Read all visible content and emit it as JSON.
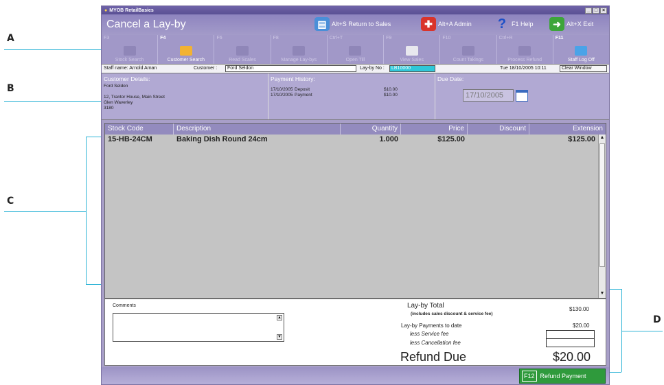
{
  "callouts": {
    "a": "A",
    "b": "B",
    "c": "C",
    "d": "D"
  },
  "window": {
    "title": "MYOB RetailBasics",
    "btn_min": "_",
    "btn_max": "□",
    "btn_close": "×"
  },
  "header": {
    "title": "Cancel a Lay-by",
    "return_sales": "Alt+S Return to Sales",
    "admin": "Alt+A Admin",
    "help": "F1 Help",
    "exit": "Alt+X Exit"
  },
  "fkeys": [
    {
      "key": "F3",
      "label": "Stock Search",
      "enabled": false
    },
    {
      "key": "F4",
      "label": "Customer Search",
      "enabled": true
    },
    {
      "key": "F6",
      "label": "Read Scales",
      "enabled": false
    },
    {
      "key": "F8",
      "label": "Manage Lay-bys",
      "enabled": false
    },
    {
      "key": "Ctrl+T",
      "label": "Open Till",
      "enabled": false
    },
    {
      "key": "F9",
      "label": "View Sales",
      "enabled": false
    },
    {
      "key": "F10",
      "label": "Count Takings",
      "enabled": false
    },
    {
      "key": "Ctrl+R",
      "label": "Process Refund",
      "enabled": false
    },
    {
      "key": "F11",
      "label": "Staff Log Off",
      "enabled": true
    }
  ],
  "infobar": {
    "staff": "Staff name: Arnold Aman",
    "customer_label": "Customer :",
    "customer_value": "Ford Seldon",
    "layby_label": "Lay-by No :",
    "layby_value": "LB10000",
    "datetime": "Tue 18/10/2005 10:11",
    "clear_window": "Clear Window"
  },
  "customer": {
    "heading": "Customer Details:",
    "name": "Ford Seldon",
    "addr1": "12, Trantor House, Main Street",
    "addr2": "Glen Waverley",
    "addr3": "3180"
  },
  "payments": {
    "heading": "Payment History:",
    "rows": [
      {
        "date": "17/10/2005",
        "type": "Deposit",
        "amount": "$10.00"
      },
      {
        "date": "17/10/2005",
        "type": "Payment",
        "amount": "$10.00"
      }
    ]
  },
  "due": {
    "heading": "Due Date:",
    "value": "17/10/2005"
  },
  "grid": {
    "columns": [
      "Stock Code",
      "Description",
      "Quantity",
      "Price",
      "Discount",
      "Extension"
    ],
    "rows": [
      {
        "code": "15-HB-24CM",
        "desc": "Baking Dish Round 24cm",
        "qty": "1.000",
        "price": "$125.00",
        "discount": "",
        "ext": "$125.00"
      }
    ]
  },
  "summary": {
    "comments_label": "Comments",
    "total_label": "Lay-by Total",
    "total_sub": "(includes sales discount & service fee)",
    "total_value": "$130.00",
    "payments_label": "Lay-by Payments to date",
    "payments_value": "$20.00",
    "service_fee_label": "less Service fee",
    "cancel_fee_label": "less Cancellation fee",
    "refund_label": "Refund Due",
    "refund_value": "$20.00"
  },
  "footer": {
    "refund_key": "F12",
    "refund_label": "Refund Payment"
  },
  "colors": {
    "accent": "#a89fc8",
    "button_green": "#2f9a3c",
    "callout_line": "#2bb3d6"
  }
}
